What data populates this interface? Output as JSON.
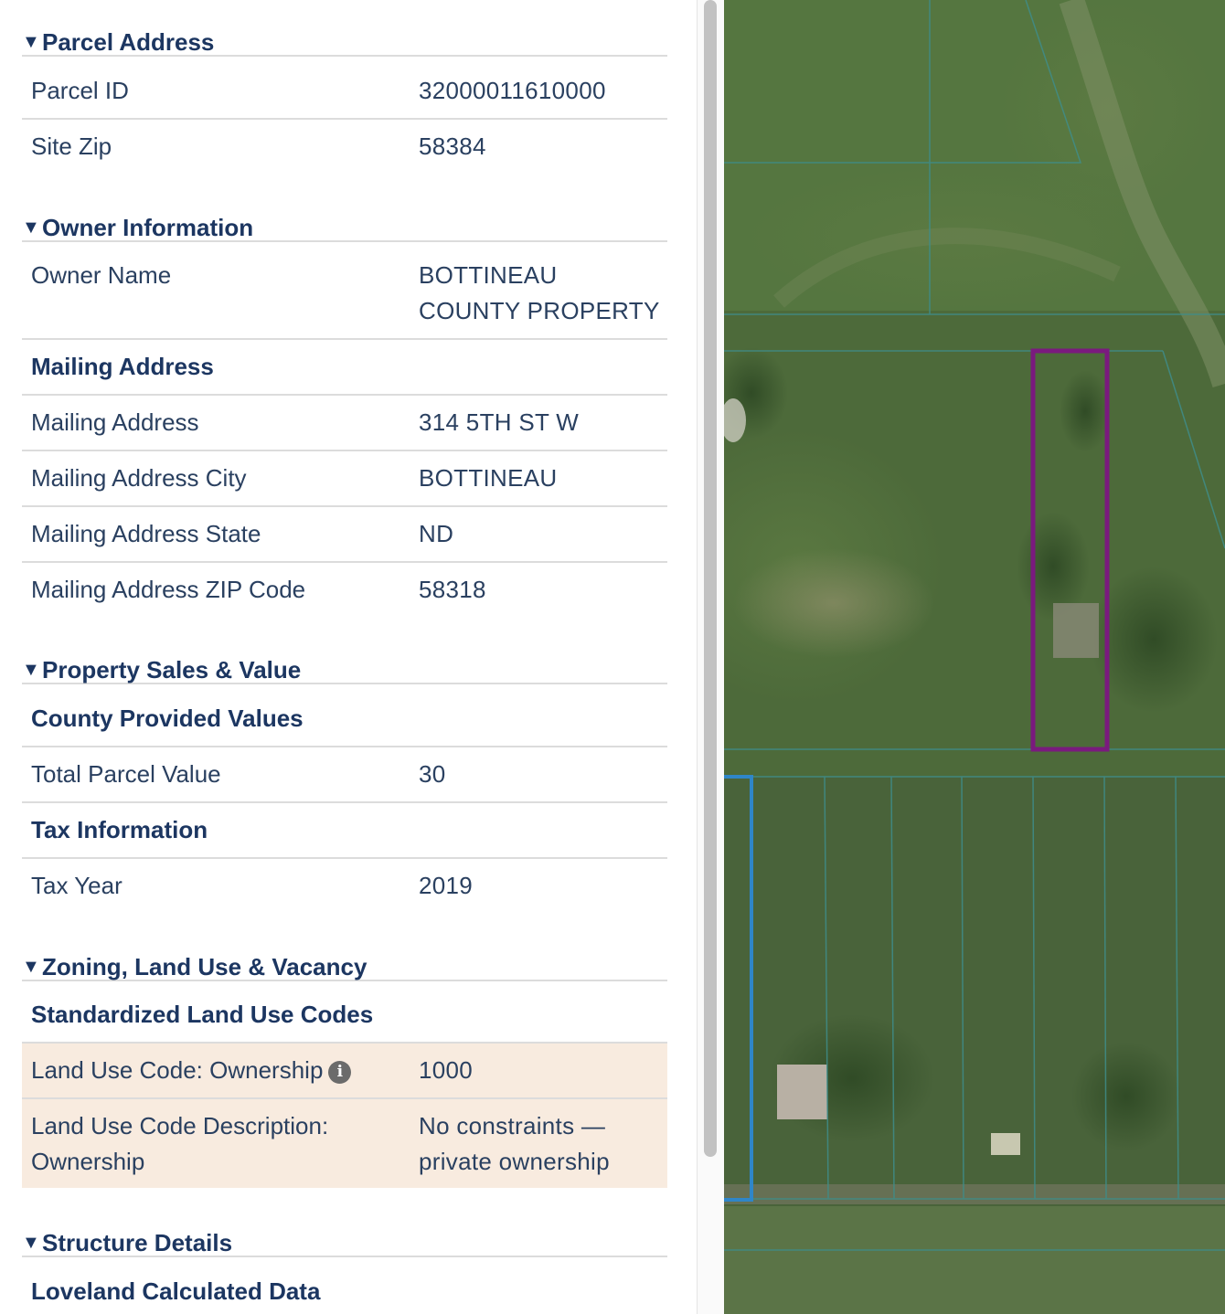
{
  "sections": {
    "parcel_address": {
      "title": "Parcel Address",
      "rows": [
        {
          "label": "Parcel ID",
          "value": "32000011610000"
        },
        {
          "label": "Site Zip",
          "value": "58384"
        }
      ]
    },
    "owner_information": {
      "title": "Owner Information",
      "owner_name": {
        "label": "Owner Name",
        "value_line1": "BOTTINEAU",
        "value_line2": "COUNTY PROPERTY"
      },
      "mailing_subhead": "Mailing Address",
      "rows": [
        {
          "label": "Mailing Address",
          "value": "314 5TH ST W"
        },
        {
          "label": "Mailing Address City",
          "value": "BOTTINEAU"
        },
        {
          "label": "Mailing Address State",
          "value": "ND"
        },
        {
          "label": "Mailing Address ZIP Code",
          "value": "58318"
        }
      ]
    },
    "property_sales": {
      "title": "Property Sales & Value",
      "county_subhead": "County Provided Values",
      "total_value": {
        "label": "Total Parcel Value",
        "value": "30"
      },
      "tax_subhead": "Tax Information",
      "tax_year": {
        "label": "Tax Year",
        "value": "2019"
      }
    },
    "zoning": {
      "title": "Zoning, Land Use & Vacancy",
      "subhead": "Standardized Land Use Codes",
      "code": {
        "label": "Land Use Code: Ownership",
        "value": "1000"
      },
      "description": {
        "label_line1": "Land Use Code Description:",
        "label_line2": "Ownership",
        "value_line1": "No constraints —",
        "value_line2": "private ownership"
      }
    },
    "structure": {
      "title": "Structure Details",
      "subhead": "Loveland Calculated Data"
    }
  },
  "icons": {
    "collapse": "triangle-down-icon",
    "info": "info-icon"
  },
  "colors": {
    "heading": "#1c3661",
    "highlight_row": "#f8ebdf",
    "selected_parcel_outline": "#7a1a7e",
    "adjacent_parcel_outline": "#2f86c8",
    "parcel_lines": "#3f8d8a"
  }
}
